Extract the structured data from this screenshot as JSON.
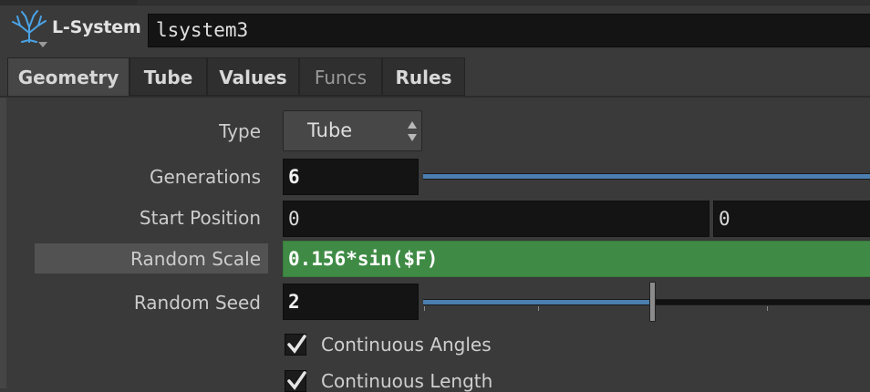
{
  "header": {
    "node_type": "L-System",
    "node_name": "lsystem3",
    "icon": "tree-branch-icon"
  },
  "tabs": [
    {
      "label": "Geometry",
      "active": true
    },
    {
      "label": "Tube",
      "active": false
    },
    {
      "label": "Values",
      "active": false
    },
    {
      "label": "Funcs",
      "active": false
    },
    {
      "label": "Rules",
      "active": false
    }
  ],
  "params": {
    "type": {
      "label": "Type",
      "value": "Tube"
    },
    "generations": {
      "label": "Generations",
      "value": "6"
    },
    "start_position": {
      "label": "Start Position",
      "x": "0",
      "y": "0"
    },
    "random_scale": {
      "label": "Random Scale",
      "value": "0.156*sin($F)"
    },
    "random_seed": {
      "label": "Random Seed",
      "value": "2"
    },
    "continuous_angles": {
      "label": "Continuous Angles",
      "checked": true
    },
    "continuous_length": {
      "label": "Continuous Length",
      "checked": true
    }
  },
  "colors": {
    "expression_field": "#3f8b45",
    "slider_fill": "#4a7fb0",
    "panel_bg": "#3a3a3a"
  }
}
